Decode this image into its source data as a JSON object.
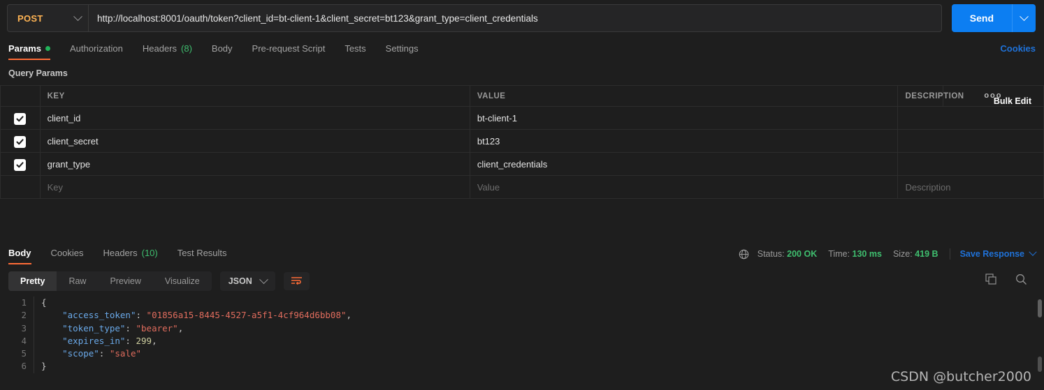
{
  "request": {
    "method": "POST",
    "url": "http://localhost:8001/oauth/token?client_id=bt-client-1&client_secret=bt123&grant_type=client_credentials",
    "send_label": "Send",
    "cookies_label": "Cookies",
    "tabs": [
      {
        "label": "Params",
        "badge": "",
        "dot": true,
        "active": true
      },
      {
        "label": "Authorization",
        "badge": "",
        "dot": false,
        "active": false
      },
      {
        "label": "Headers",
        "badge": "(8)",
        "dot": false,
        "active": false
      },
      {
        "label": "Body",
        "badge": "",
        "dot": false,
        "active": false
      },
      {
        "label": "Pre-request Script",
        "badge": "",
        "dot": false,
        "active": false
      },
      {
        "label": "Tests",
        "badge": "",
        "dot": false,
        "active": false
      },
      {
        "label": "Settings",
        "badge": "",
        "dot": false,
        "active": false
      }
    ]
  },
  "query_params": {
    "section_title": "Query Params",
    "headers": {
      "key": "KEY",
      "value": "VALUE",
      "description": "DESCRIPTION"
    },
    "bulk_edit_label": "Bulk Edit",
    "menu_label": "ooo",
    "rows": [
      {
        "checked": true,
        "key": "client_id",
        "value": "bt-client-1",
        "description": ""
      },
      {
        "checked": true,
        "key": "client_secret",
        "value": "bt123",
        "description": ""
      },
      {
        "checked": true,
        "key": "grant_type",
        "value": "client_credentials",
        "description": ""
      }
    ],
    "placeholder_row": {
      "key": "Key",
      "value": "Value",
      "description": "Description"
    }
  },
  "response": {
    "tabs": [
      {
        "label": "Body",
        "badge": "",
        "active": true
      },
      {
        "label": "Cookies",
        "badge": "",
        "active": false
      },
      {
        "label": "Headers",
        "badge": "(10)",
        "active": false
      },
      {
        "label": "Test Results",
        "badge": "",
        "active": false
      }
    ],
    "status": {
      "status_label": "Status:",
      "status_value": "200 OK",
      "time_label": "Time:",
      "time_value": "130 ms",
      "size_label": "Size:",
      "size_value": "419 B"
    },
    "save_response_label": "Save Response",
    "view_modes": [
      "Pretty",
      "Raw",
      "Preview",
      "Visualize"
    ],
    "active_view_mode": "Pretty",
    "format": "JSON",
    "body_lines": [
      {
        "n": "1",
        "text": "{"
      },
      {
        "n": "2",
        "text": "    \"access_token\": \"01856a15-8445-4527-a5f1-4cf964d6bb08\","
      },
      {
        "n": "3",
        "text": "    \"token_type\": \"bearer\","
      },
      {
        "n": "4",
        "text": "    \"expires_in\": 299,"
      },
      {
        "n": "5",
        "text": "    \"scope\": \"sale\""
      },
      {
        "n": "6",
        "text": "}"
      }
    ],
    "json_body": {
      "access_token": "01856a15-8445-4527-a5f1-4cf964d6bb08",
      "token_type": "bearer",
      "expires_in": 299,
      "scope": "sale"
    }
  },
  "watermark": "CSDN @butcher2000",
  "colors": {
    "accent_orange": "#ff6c37",
    "send_blue": "#0c7ef2",
    "link_blue": "#1f72d9",
    "status_green": "#3fbf6f",
    "method_amber": "#ffb454",
    "background": "#1e1e1e"
  }
}
